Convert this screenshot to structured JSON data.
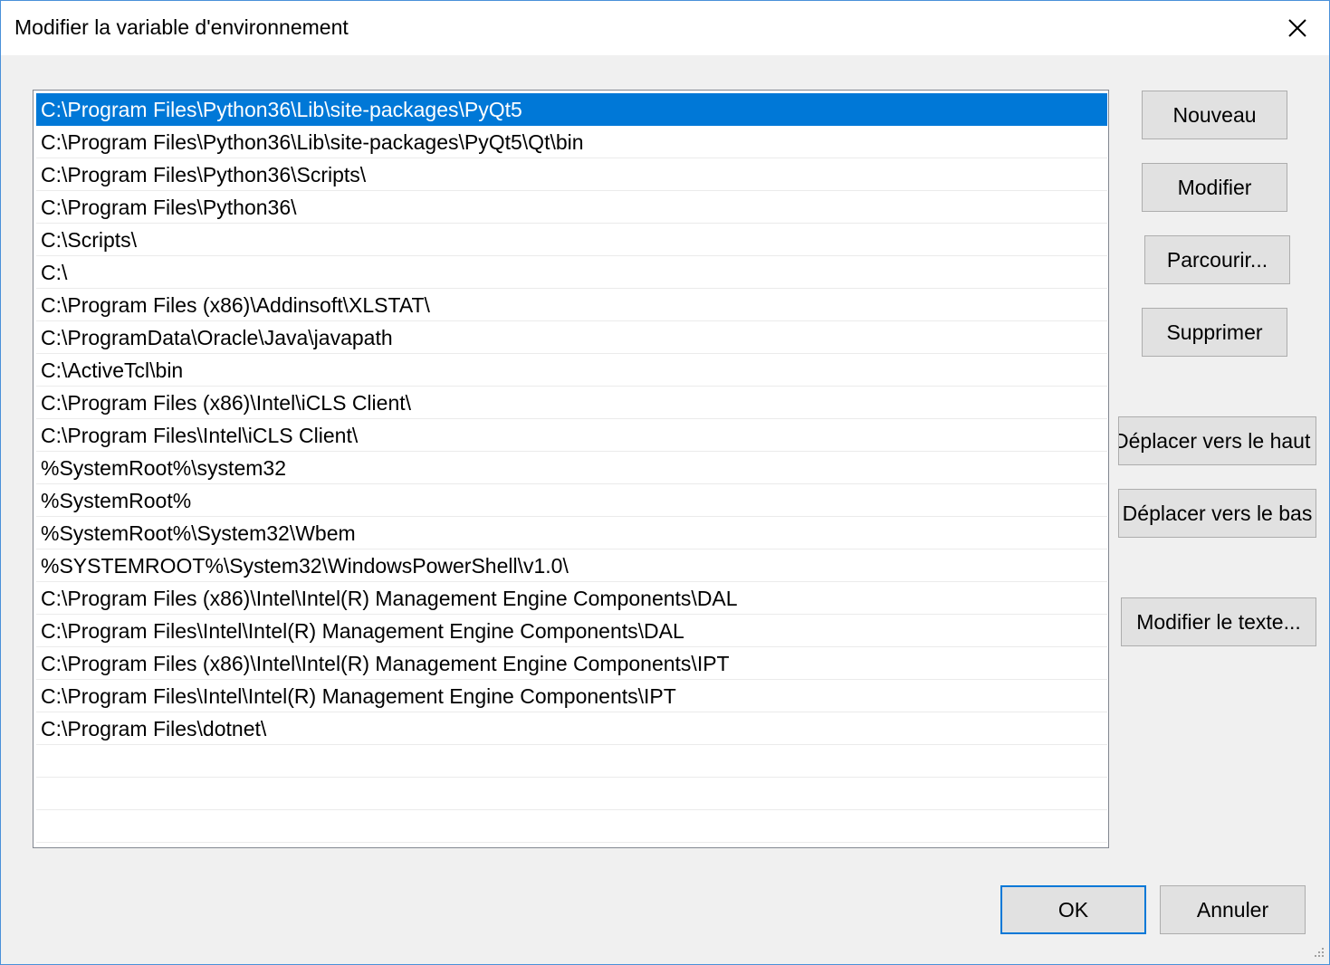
{
  "window": {
    "title": "Modifier la variable d'environnement"
  },
  "paths": [
    "C:\\Program Files\\Python36\\Lib\\site-packages\\PyQt5",
    "C:\\Program Files\\Python36\\Lib\\site-packages\\PyQt5\\Qt\\bin",
    "C:\\Program Files\\Python36\\Scripts\\",
    "C:\\Program Files\\Python36\\",
    "C:\\Scripts\\",
    "C:\\",
    "C:\\Program Files (x86)\\Addinsoft\\XLSTAT\\",
    "C:\\ProgramData\\Oracle\\Java\\javapath",
    "C:\\ActiveTcl\\bin",
    "C:\\Program Files (x86)\\Intel\\iCLS Client\\",
    "C:\\Program Files\\Intel\\iCLS Client\\",
    "%SystemRoot%\\system32",
    "%SystemRoot%",
    "%SystemRoot%\\System32\\Wbem",
    "%SYSTEMROOT%\\System32\\WindowsPowerShell\\v1.0\\",
    "C:\\Program Files (x86)\\Intel\\Intel(R) Management Engine Components\\DAL",
    "C:\\Program Files\\Intel\\Intel(R) Management Engine Components\\DAL",
    "C:\\Program Files (x86)\\Intel\\Intel(R) Management Engine Components\\IPT",
    "C:\\Program Files\\Intel\\Intel(R) Management Engine Components\\IPT",
    "C:\\Program Files\\dotnet\\",
    "",
    "",
    ""
  ],
  "selected_index": 0,
  "buttons": {
    "new": "Nouveau",
    "edit": "Modifier",
    "browse": "Parcourir...",
    "delete": "Supprimer",
    "move_up": "Déplacer vers le haut",
    "move_down": "Déplacer vers le bas",
    "edit_text": "Modifier le texte...",
    "ok": "OK",
    "cancel": "Annuler"
  },
  "colors": {
    "selection": "#0078d7",
    "button_face": "#e1e1e1",
    "window_border": "#4a90d9"
  }
}
